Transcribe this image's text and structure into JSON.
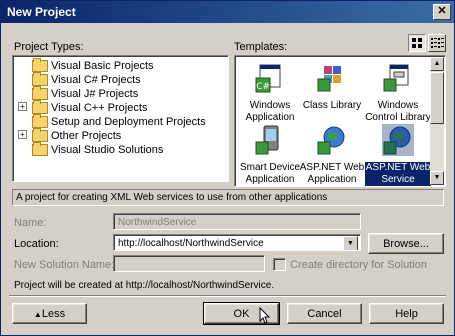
{
  "window": {
    "title": "New Project",
    "close_glyph": "✕"
  },
  "project_types": {
    "label": "Project Types:",
    "items": [
      {
        "label": "Visual Basic Projects",
        "expandable": false
      },
      {
        "label": "Visual C# Projects",
        "expandable": false
      },
      {
        "label": "Visual J# Projects",
        "expandable": false
      },
      {
        "label": "Visual C++ Projects",
        "expandable": true
      },
      {
        "label": "Setup and Deployment Projects",
        "expandable": false
      },
      {
        "label": "Other Projects",
        "expandable": true
      },
      {
        "label": "Visual Studio Solutions",
        "expandable": false
      }
    ],
    "expander_glyph": "+"
  },
  "templates": {
    "label": "Templates:",
    "items": [
      {
        "label1": "Windows",
        "label2": "Application",
        "icon": "windows-application-icon",
        "selected": false
      },
      {
        "label1": "Class Library",
        "label2": "",
        "icon": "class-library-icon",
        "selected": false
      },
      {
        "label1": "Windows",
        "label2": "Control Library",
        "icon": "windows-control-library-icon",
        "selected": false
      },
      {
        "label1": "Smart Device",
        "label2": "Application",
        "icon": "smart-device-icon",
        "selected": false
      },
      {
        "label1": "ASP.NET Web",
        "label2": "Application",
        "icon": "aspnet-web-app-icon",
        "selected": false
      },
      {
        "label1": "ASP.NET Web",
        "label2": "Service",
        "icon": "aspnet-web-service-icon",
        "selected": true
      }
    ]
  },
  "description": "A project for creating XML Web services to use from other applications",
  "name": {
    "label": "Name:",
    "value": "NorthwindService"
  },
  "location": {
    "label": "Location:",
    "value": "http://localhost/NorthwindService",
    "browse_label": "Browse..."
  },
  "new_solution": {
    "label": "New Solution Name:",
    "value": "",
    "checkbox_label": "Create directory for Solution"
  },
  "created_at": "Project will be created at http://localhost/NorthwindService.",
  "buttons": {
    "less": "Less",
    "ok": "OK",
    "cancel": "Cancel",
    "help": "Help"
  },
  "colors": {
    "selection": "#0a246a",
    "title_start": "#0a246a",
    "title_end": "#3a6ea5",
    "face": "#d4d0c8"
  }
}
